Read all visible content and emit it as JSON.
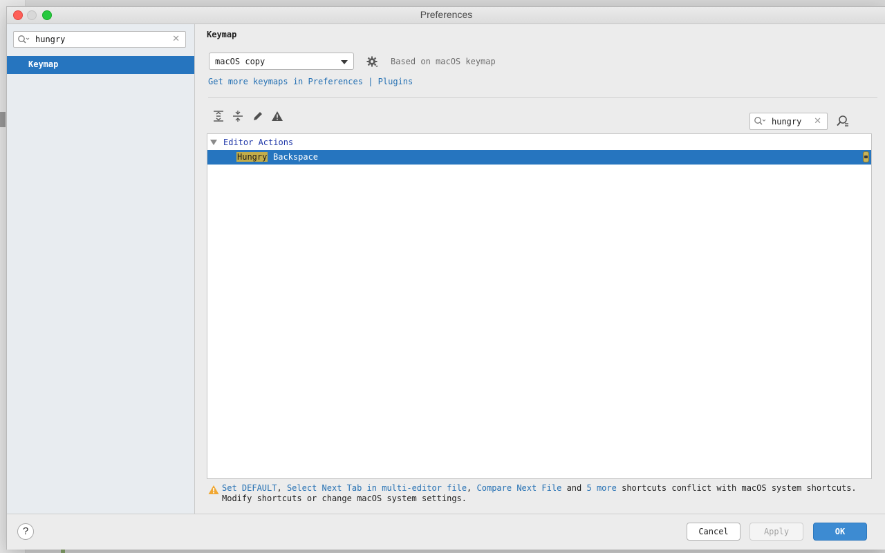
{
  "window": {
    "title": "Preferences"
  },
  "sidebar": {
    "search_value": "hungry",
    "items": [
      {
        "label": "Keymap",
        "selected": true
      }
    ]
  },
  "keymap": {
    "section_title": "Keymap",
    "selected_keymap": "macOS copy",
    "based_on": "Based on macOS keymap",
    "link_get_more": "Get more keymaps in Preferences",
    "link_separator": "|",
    "link_plugins": "Plugins"
  },
  "toolbar": {
    "icons": [
      "expand-all-icon",
      "collapse-all-icon",
      "edit-icon",
      "conflicts-warning-icon"
    ],
    "search_value": "hungry",
    "find_shortcut_icon": "find-by-shortcut-icon"
  },
  "tree": {
    "group_label": "Editor Actions",
    "rows": [
      {
        "match": "Hungry",
        "rest": "Backspace",
        "selected": true
      }
    ]
  },
  "warning": {
    "link1": "Set DEFAULT",
    "sep1": ",",
    "link2": "Select Next Tab in multi-editor file",
    "sep2": ",",
    "link3": "Compare Next File",
    "and_text": "and",
    "link4": "5 more",
    "text1": "shortcuts conflict with macOS system shortcuts.",
    "text2": "Modify shortcuts or change macOS system settings."
  },
  "buttons": {
    "help": "?",
    "cancel": "Cancel",
    "apply": "Apply",
    "ok": "OK"
  },
  "colors": {
    "selection": "#2675bf",
    "link": "#2470b3",
    "group_label": "#1f37a8",
    "match_highlight": "#c2ad4a",
    "ok_button": "#3d8bd2"
  }
}
